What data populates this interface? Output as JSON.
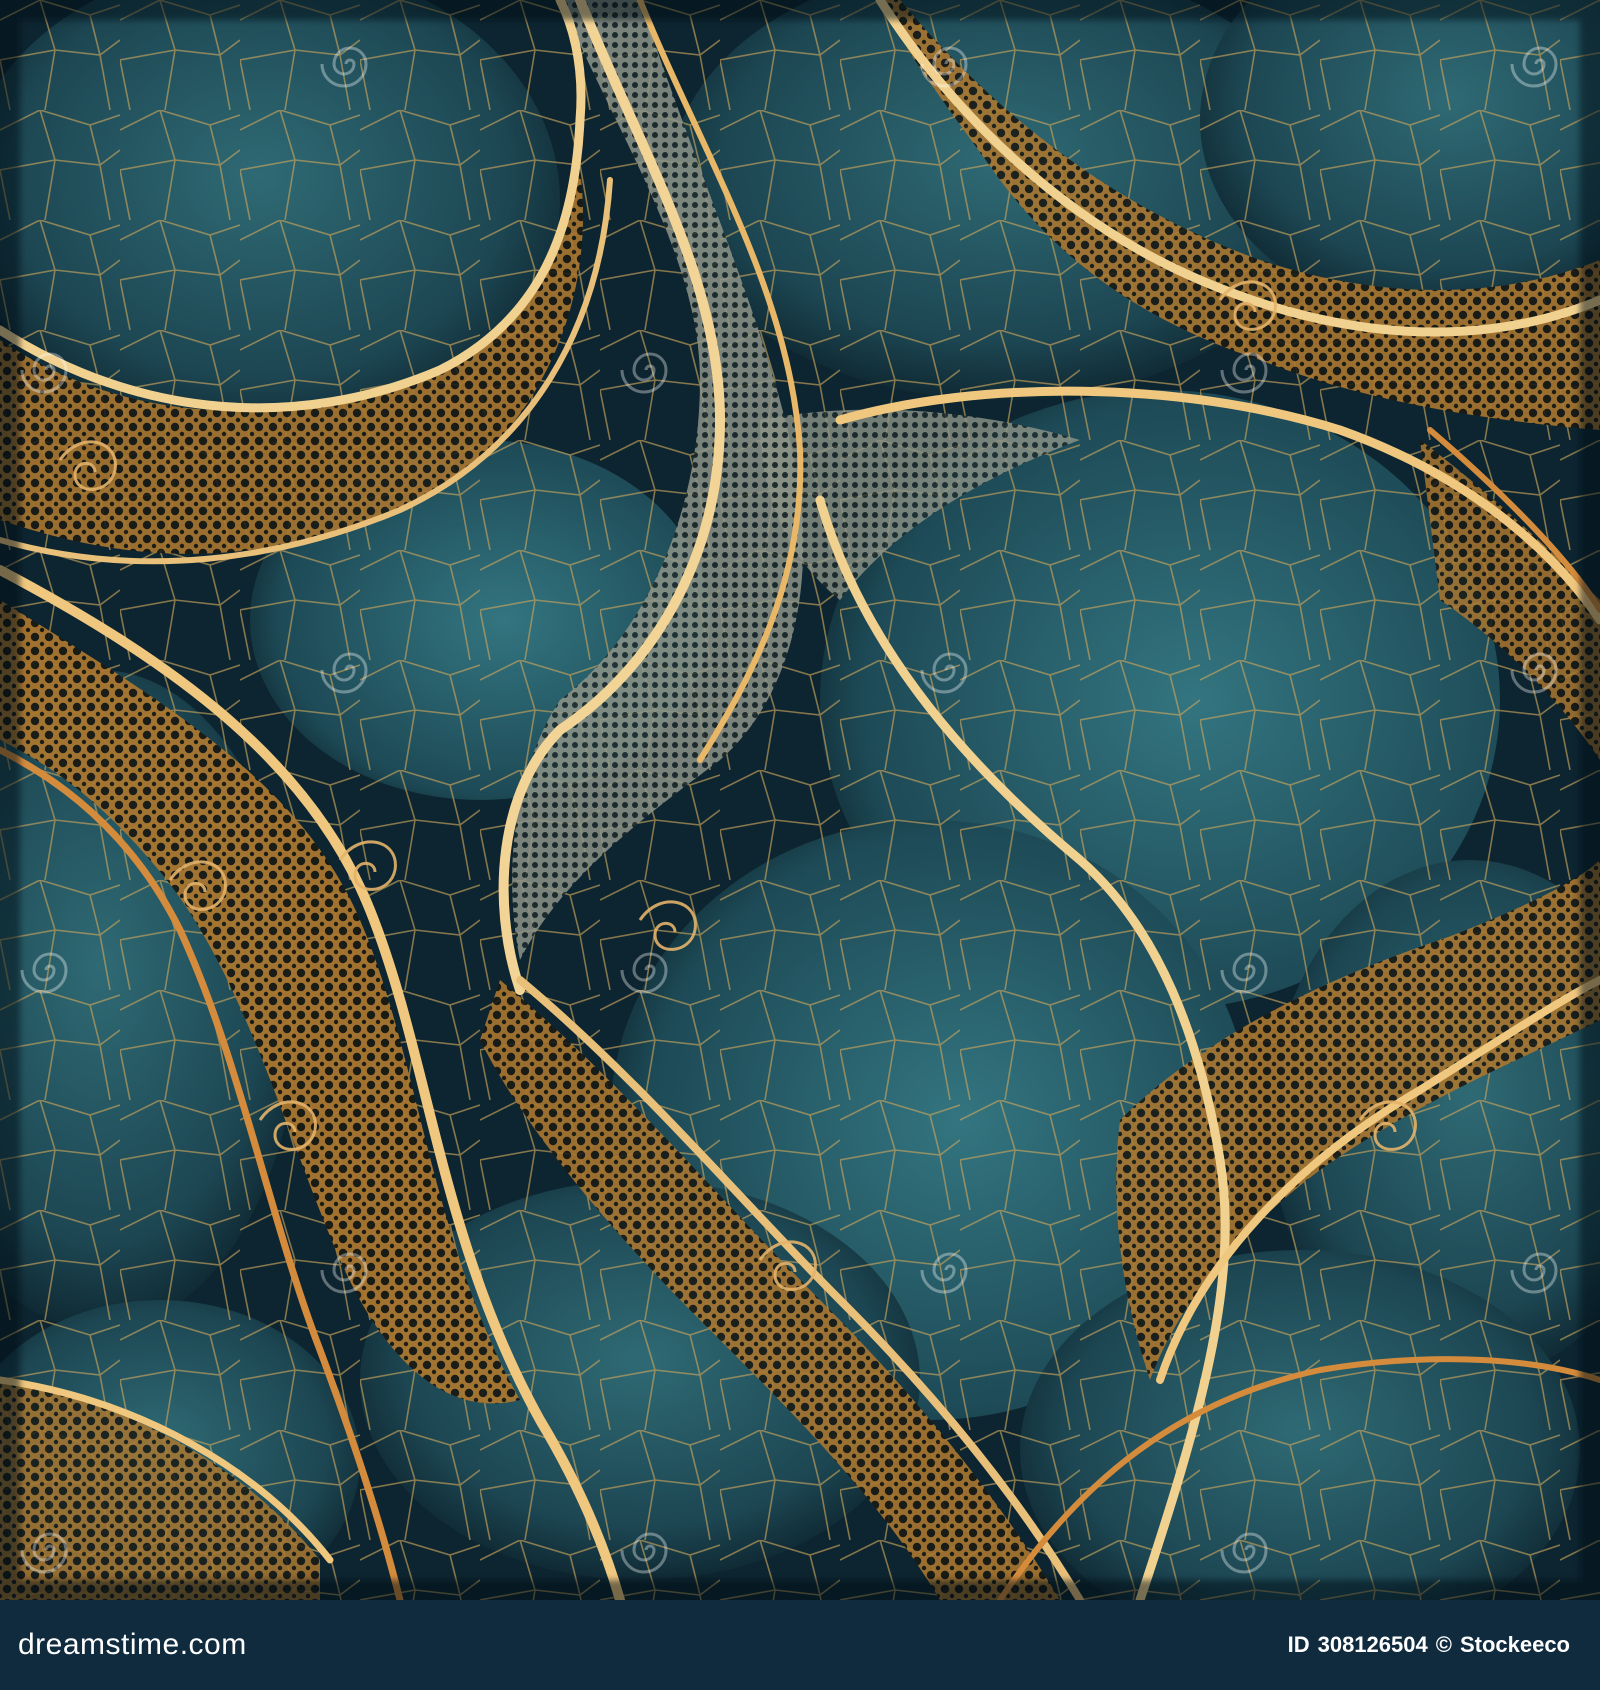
{
  "watermark": {
    "text": "dreamstime"
  },
  "footer": {
    "brand": "dreamstime.com",
    "id_label": "ID",
    "id_value": "308126504",
    "copyright": "©",
    "author": "Stockeeco"
  },
  "colors": {
    "background_teal": "#1e4a56",
    "deep_teal": "#0d2530",
    "gold": "#e8b868",
    "orange": "#c9732d",
    "cream": "#f3e2b6",
    "footer_bg": "#0f2b3d"
  }
}
